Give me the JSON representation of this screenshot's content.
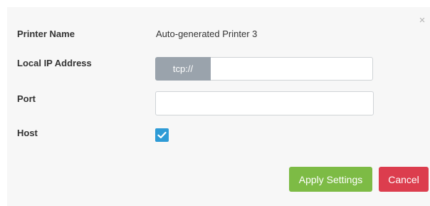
{
  "dialog": {
    "close_glyph": "×",
    "fields": {
      "printer_name": {
        "label": "Printer Name",
        "value": "Auto-generated Printer 3"
      },
      "local_ip": {
        "label": "Local IP Address",
        "prefix": "tcp://",
        "value": "",
        "placeholder": ""
      },
      "port": {
        "label": "Port",
        "value": "",
        "placeholder": ""
      },
      "host": {
        "label": "Host",
        "checked": true
      }
    },
    "buttons": {
      "apply_label": "Apply Settings",
      "cancel_label": "Cancel"
    }
  },
  "colors": {
    "apply": "#7dbb45",
    "cancel": "#dc3d4e",
    "checkbox": "#2e9bd6",
    "prefix_addon": "#9aa3ac"
  },
  "icons": {
    "close": "close-icon",
    "check": "check-icon"
  }
}
